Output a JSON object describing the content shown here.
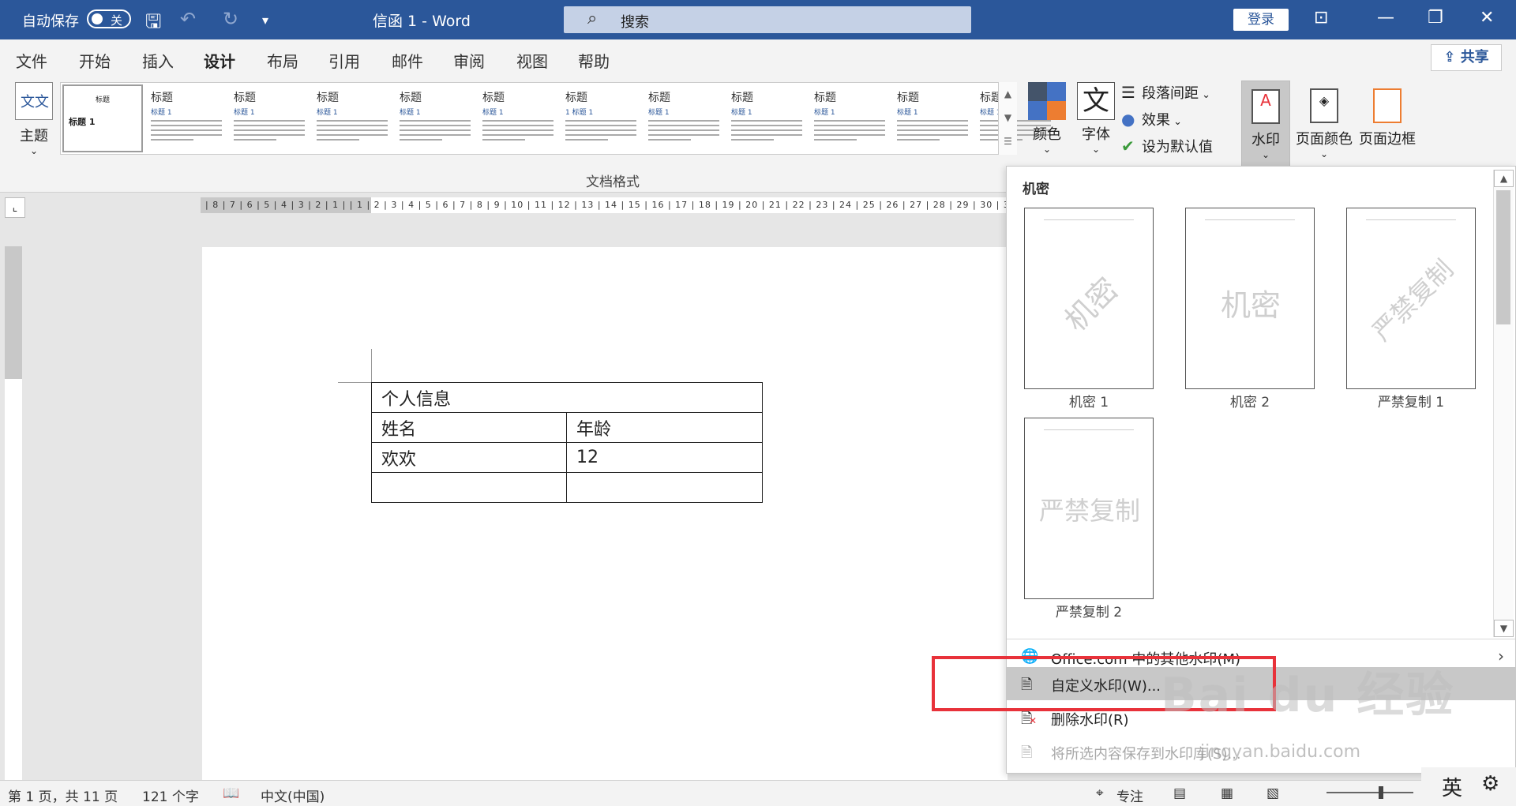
{
  "titlebar": {
    "autosave_label": "自动保存",
    "autosave_state": "关",
    "doc_title": "信函 1  -  Word",
    "search_placeholder": "搜索",
    "login_label": "登录"
  },
  "menu": {
    "tabs": [
      "文件",
      "开始",
      "插入",
      "设计",
      "布局",
      "引用",
      "邮件",
      "审阅",
      "视图",
      "帮助"
    ],
    "active_tab": "设计",
    "share_label": "共享"
  },
  "ribbon": {
    "theme_label": "主题",
    "theme_icon_text": "文文",
    "gallery": [
      {
        "title": "标题",
        "sub": "标题 1"
      },
      {
        "title": "标题",
        "sub": "标题 1"
      },
      {
        "title": "标题",
        "sub": "标题 1"
      },
      {
        "title": "标题",
        "sub": "标题 1"
      },
      {
        "title": "标题",
        "sub": "标题 1"
      },
      {
        "title": "标题",
        "sub": "1 标题 1"
      },
      {
        "title": "标题",
        "sub": "标题 1"
      },
      {
        "title": "标题",
        "sub": "标题 1"
      },
      {
        "title": "标题",
        "sub": "标题 1"
      },
      {
        "title": "标题",
        "sub": "标题 1"
      },
      {
        "title": "标题",
        "sub": "标题 1"
      }
    ],
    "gallery_selected_title": "标题",
    "gallery_selected_sub": "标题 1",
    "group_label": "文档格式",
    "colors_label": "颜色",
    "fonts_label": "字体",
    "fonts_icon_text": "文",
    "paragraph_spacing_label": "段落间距",
    "effects_label": "效果",
    "set_default_label": "设为默认值",
    "watermark_label": "水印",
    "page_color_label": "页面颜色",
    "page_borders_label": "页面边框"
  },
  "ruler": {
    "numbers": "| 8 | 7 | 6 | 5 | 4 | 3 | 2 | 1 |   | 1 | 2 | 3 | 4 | 5 | 6 | 7 | 8 | 9 | 10 | 11 | 12 | 13 | 14 | 15 | 16 | 17 | 18 | 19 | 20 | 21 | 22 | 23 | 24 | 25 | 26 | 27 | 28 | 29 | 30 | 31 | 3"
  },
  "document": {
    "table": {
      "header": "个人信息",
      "rows": [
        [
          "姓名",
          "年龄"
        ],
        [
          "欢欢",
          "12"
        ],
        [
          "",
          ""
        ]
      ]
    }
  },
  "watermark_menu": {
    "section_header": "机密",
    "thumbnails": [
      {
        "label": "机密 1",
        "text": "机密",
        "style": "diagonal"
      },
      {
        "label": "机密 2",
        "text": "机密",
        "style": "horizontal"
      },
      {
        "label": "严禁复制 1",
        "text": "严禁复制",
        "style": "diagonal"
      },
      {
        "label": "严禁复制 2",
        "text": "严禁复制",
        "style": "horizontal"
      }
    ],
    "items": {
      "more_office": "Office.com 中的其他水印(M)",
      "custom": "自定义水印(W)...",
      "remove": "删除水印(R)",
      "save_selection": "将所选内容保存到水印库(S)..."
    }
  },
  "statusbar": {
    "page_info": "第 1 页，共 11 页",
    "word_count": "121 个字",
    "language": "中文(中国)",
    "focus_label": "专注"
  },
  "ime": {
    "mode": "英"
  },
  "overlay_watermark": {
    "brand": "Bai du 经验",
    "url": "jingyan.baidu.com"
  },
  "colors": {
    "title_bar": "#2b579a",
    "highlight_box": "#e8323a"
  }
}
